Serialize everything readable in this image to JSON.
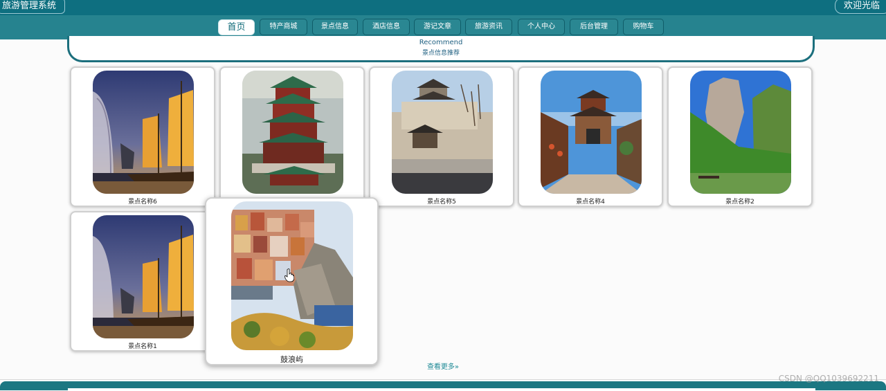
{
  "header": {
    "brand": "旅游管理系统",
    "welcome": "欢迎光临"
  },
  "nav": {
    "items": [
      {
        "label": "首页",
        "active": true
      },
      {
        "label": "特产商城"
      },
      {
        "label": "景点信息"
      },
      {
        "label": "酒店信息"
      },
      {
        "label": "游记文章"
      },
      {
        "label": "旅游资讯"
      },
      {
        "label": "个人中心"
      },
      {
        "label": "后台管理"
      },
      {
        "label": "购物车"
      }
    ]
  },
  "recommend": {
    "title_en": "Recommend",
    "title_cn": "景点信息推荐"
  },
  "cards": [
    {
      "name": "景点名称6",
      "picture": "sailboat-harbor-night"
    },
    {
      "name": "",
      "picture": "tengwang-pavilion"
    },
    {
      "name": "景点名称5",
      "picture": "city-wall-gate-tower"
    },
    {
      "name": "景点名称4",
      "picture": "ancient-town-gate-street"
    },
    {
      "name": "景点名称2",
      "picture": "karst-peak-river"
    },
    {
      "name": "景点名称1",
      "picture": "sailboat-harbor-night"
    },
    {
      "name": "鼓浪屿",
      "picture": "cliffside-colorful-village"
    }
  ],
  "more_label": "查看更多»",
  "watermark": "CSDN @QQ1039692211",
  "colors": {
    "topbar": "#0e6f80",
    "navbar": "#26838f",
    "accent": "#1e8a96"
  }
}
